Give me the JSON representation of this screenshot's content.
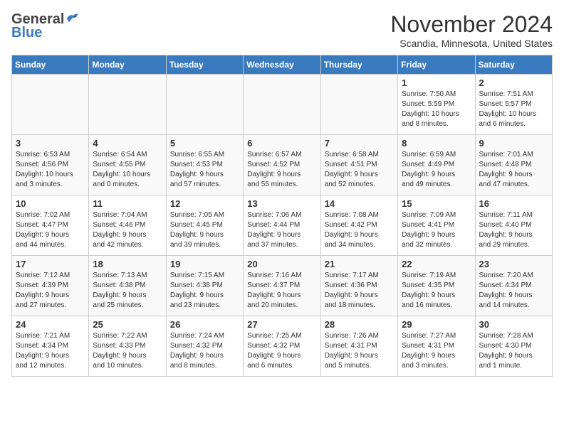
{
  "header": {
    "logo_general": "General",
    "logo_blue": "Blue",
    "title": "November 2024",
    "location": "Scandia, Minnesota, United States"
  },
  "weekdays": [
    "Sunday",
    "Monday",
    "Tuesday",
    "Wednesday",
    "Thursday",
    "Friday",
    "Saturday"
  ],
  "weeks": [
    {
      "row_class": "row-white",
      "days": [
        {
          "num": "",
          "info": "",
          "empty": true
        },
        {
          "num": "",
          "info": "",
          "empty": true
        },
        {
          "num": "",
          "info": "",
          "empty": true
        },
        {
          "num": "",
          "info": "",
          "empty": true
        },
        {
          "num": "",
          "info": "",
          "empty": true
        },
        {
          "num": "1",
          "info": "Sunrise: 7:50 AM\nSunset: 5:59 PM\nDaylight: 10 hours\nand 8 minutes.",
          "empty": false
        },
        {
          "num": "2",
          "info": "Sunrise: 7:51 AM\nSunset: 5:57 PM\nDaylight: 10 hours\nand 6 minutes.",
          "empty": false
        }
      ]
    },
    {
      "row_class": "row-gray",
      "days": [
        {
          "num": "3",
          "info": "Sunrise: 6:53 AM\nSunset: 4:56 PM\nDaylight: 10 hours\nand 3 minutes.",
          "empty": false
        },
        {
          "num": "4",
          "info": "Sunrise: 6:54 AM\nSunset: 4:55 PM\nDaylight: 10 hours\nand 0 minutes.",
          "empty": false
        },
        {
          "num": "5",
          "info": "Sunrise: 6:55 AM\nSunset: 4:53 PM\nDaylight: 9 hours\nand 57 minutes.",
          "empty": false
        },
        {
          "num": "6",
          "info": "Sunrise: 6:57 AM\nSunset: 4:52 PM\nDaylight: 9 hours\nand 55 minutes.",
          "empty": false
        },
        {
          "num": "7",
          "info": "Sunrise: 6:58 AM\nSunset: 4:51 PM\nDaylight: 9 hours\nand 52 minutes.",
          "empty": false
        },
        {
          "num": "8",
          "info": "Sunrise: 6:59 AM\nSunset: 4:49 PM\nDaylight: 9 hours\nand 49 minutes.",
          "empty": false
        },
        {
          "num": "9",
          "info": "Sunrise: 7:01 AM\nSunset: 4:48 PM\nDaylight: 9 hours\nand 47 minutes.",
          "empty": false
        }
      ]
    },
    {
      "row_class": "row-white",
      "days": [
        {
          "num": "10",
          "info": "Sunrise: 7:02 AM\nSunset: 4:47 PM\nDaylight: 9 hours\nand 44 minutes.",
          "empty": false
        },
        {
          "num": "11",
          "info": "Sunrise: 7:04 AM\nSunset: 4:46 PM\nDaylight: 9 hours\nand 42 minutes.",
          "empty": false
        },
        {
          "num": "12",
          "info": "Sunrise: 7:05 AM\nSunset: 4:45 PM\nDaylight: 9 hours\nand 39 minutes.",
          "empty": false
        },
        {
          "num": "13",
          "info": "Sunrise: 7:06 AM\nSunset: 4:44 PM\nDaylight: 9 hours\nand 37 minutes.",
          "empty": false
        },
        {
          "num": "14",
          "info": "Sunrise: 7:08 AM\nSunset: 4:42 PM\nDaylight: 9 hours\nand 34 minutes.",
          "empty": false
        },
        {
          "num": "15",
          "info": "Sunrise: 7:09 AM\nSunset: 4:41 PM\nDaylight: 9 hours\nand 32 minutes.",
          "empty": false
        },
        {
          "num": "16",
          "info": "Sunrise: 7:11 AM\nSunset: 4:40 PM\nDaylight: 9 hours\nand 29 minutes.",
          "empty": false
        }
      ]
    },
    {
      "row_class": "row-gray",
      "days": [
        {
          "num": "17",
          "info": "Sunrise: 7:12 AM\nSunset: 4:39 PM\nDaylight: 9 hours\nand 27 minutes.",
          "empty": false
        },
        {
          "num": "18",
          "info": "Sunrise: 7:13 AM\nSunset: 4:38 PM\nDaylight: 9 hours\nand 25 minutes.",
          "empty": false
        },
        {
          "num": "19",
          "info": "Sunrise: 7:15 AM\nSunset: 4:38 PM\nDaylight: 9 hours\nand 23 minutes.",
          "empty": false
        },
        {
          "num": "20",
          "info": "Sunrise: 7:16 AM\nSunset: 4:37 PM\nDaylight: 9 hours\nand 20 minutes.",
          "empty": false
        },
        {
          "num": "21",
          "info": "Sunrise: 7:17 AM\nSunset: 4:36 PM\nDaylight: 9 hours\nand 18 minutes.",
          "empty": false
        },
        {
          "num": "22",
          "info": "Sunrise: 7:19 AM\nSunset: 4:35 PM\nDaylight: 9 hours\nand 16 minutes.",
          "empty": false
        },
        {
          "num": "23",
          "info": "Sunrise: 7:20 AM\nSunset: 4:34 PM\nDaylight: 9 hours\nand 14 minutes.",
          "empty": false
        }
      ]
    },
    {
      "row_class": "row-white",
      "days": [
        {
          "num": "24",
          "info": "Sunrise: 7:21 AM\nSunset: 4:34 PM\nDaylight: 9 hours\nand 12 minutes.",
          "empty": false
        },
        {
          "num": "25",
          "info": "Sunrise: 7:22 AM\nSunset: 4:33 PM\nDaylight: 9 hours\nand 10 minutes.",
          "empty": false
        },
        {
          "num": "26",
          "info": "Sunrise: 7:24 AM\nSunset: 4:32 PM\nDaylight: 9 hours\nand 8 minutes.",
          "empty": false
        },
        {
          "num": "27",
          "info": "Sunrise: 7:25 AM\nSunset: 4:32 PM\nDaylight: 9 hours\nand 6 minutes.",
          "empty": false
        },
        {
          "num": "28",
          "info": "Sunrise: 7:26 AM\nSunset: 4:31 PM\nDaylight: 9 hours\nand 5 minutes.",
          "empty": false
        },
        {
          "num": "29",
          "info": "Sunrise: 7:27 AM\nSunset: 4:31 PM\nDaylight: 9 hours\nand 3 minutes.",
          "empty": false
        },
        {
          "num": "30",
          "info": "Sunrise: 7:28 AM\nSunset: 4:30 PM\nDaylight: 9 hours\nand 1 minute.",
          "empty": false
        }
      ]
    }
  ]
}
